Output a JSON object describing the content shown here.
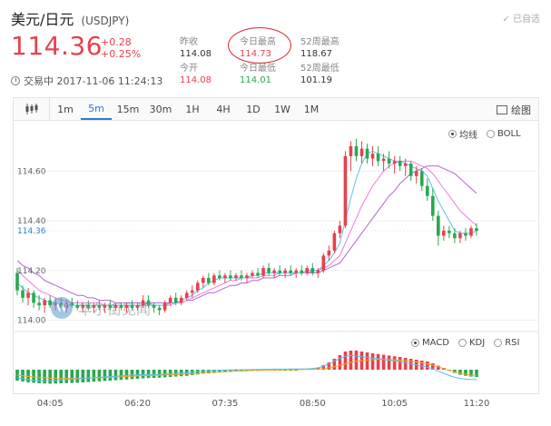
{
  "header": {
    "title": "美元/日元",
    "symbol": "(USDJPY)",
    "follow_label": "已自选",
    "price": "114.36",
    "change_abs": "+0.28",
    "change_pct": "+0.25%"
  },
  "stats": [
    {
      "label": "昨收",
      "value": "114.08",
      "tone": "normal"
    },
    {
      "label": "今日最高",
      "value": "114.73",
      "tone": "red"
    },
    {
      "label": "52周最高",
      "value": "118.67",
      "tone": "normal"
    },
    {
      "label": "今开",
      "value": "114.08",
      "tone": "red"
    },
    {
      "label": "今日最低",
      "value": "114.01",
      "tone": "green"
    },
    {
      "label": "52周最低",
      "value": "101.19",
      "tone": "normal"
    }
  ],
  "status": {
    "text": "交易中 2017-11-06 11:24:13"
  },
  "tabs": [
    {
      "label": "1m",
      "active": false
    },
    {
      "label": "5m",
      "active": true
    },
    {
      "label": "15m",
      "active": false
    },
    {
      "label": "30m",
      "active": false
    },
    {
      "label": "1H",
      "active": false
    },
    {
      "label": "4H",
      "active": false
    },
    {
      "label": "1D",
      "active": false
    },
    {
      "label": "1W",
      "active": false
    },
    {
      "label": "1M",
      "active": false
    }
  ],
  "draw_label": "绘图",
  "main_indicators": [
    {
      "label": "均线",
      "selected": true
    },
    {
      "label": "BOLL",
      "selected": false
    }
  ],
  "sub_indicators": [
    {
      "label": "MACD",
      "selected": true
    },
    {
      "label": "KDJ",
      "selected": false
    },
    {
      "label": "RSI",
      "selected": false
    }
  ],
  "watermark": {
    "logo": "W",
    "text": "华尔街见闻"
  },
  "colors": {
    "up": "#e5424d",
    "down": "#2aa850",
    "accent": "#2b7bd8",
    "ma_fast": "#5bc0eb",
    "ma_mid": "#f37ad6",
    "ma_slow": "#b066d6",
    "dea": "#f5a623"
  },
  "chart_data": {
    "type": "candlestick",
    "ylim": [
      113.98,
      114.74
    ],
    "y_ticks": [
      "114.60",
      "114.40",
      "114.20",
      "114.00"
    ],
    "current_price_label": "114.36",
    "x_ticks": [
      "04:05",
      "06:20",
      "07:35",
      "08:50",
      "10:05",
      "11:20"
    ],
    "candles": [
      [
        114.19,
        114.21,
        114.1,
        114.12
      ],
      [
        114.12,
        114.14,
        114.07,
        114.09
      ],
      [
        114.09,
        114.13,
        114.06,
        114.11
      ],
      [
        114.11,
        114.12,
        114.05,
        114.07
      ],
      [
        114.07,
        114.1,
        114.04,
        114.06
      ],
      [
        114.06,
        114.09,
        114.03,
        114.08
      ],
      [
        114.08,
        114.1,
        114.05,
        114.06
      ],
      [
        114.06,
        114.09,
        114.04,
        114.07
      ],
      [
        114.07,
        114.09,
        114.04,
        114.05
      ],
      [
        114.05,
        114.08,
        114.03,
        114.07
      ],
      [
        114.07,
        114.09,
        114.05,
        114.06
      ],
      [
        114.06,
        114.08,
        114.04,
        114.05
      ],
      [
        114.05,
        114.07,
        114.03,
        114.06
      ],
      [
        114.06,
        114.08,
        114.04,
        114.05
      ],
      [
        114.05,
        114.07,
        114.03,
        114.06
      ],
      [
        114.06,
        114.08,
        114.04,
        114.05
      ],
      [
        114.05,
        114.07,
        114.03,
        114.06
      ],
      [
        114.06,
        114.08,
        114.04,
        114.05
      ],
      [
        114.05,
        114.07,
        114.04,
        114.06
      ],
      [
        114.06,
        114.07,
        114.04,
        114.05
      ],
      [
        114.05,
        114.07,
        114.03,
        114.06
      ],
      [
        114.06,
        114.08,
        114.04,
        114.05
      ],
      [
        114.05,
        114.07,
        114.04,
        114.06
      ],
      [
        114.06,
        114.1,
        114.05,
        114.08
      ],
      [
        114.08,
        114.1,
        114.05,
        114.06
      ],
      [
        114.06,
        114.07,
        114.03,
        114.05
      ],
      [
        114.05,
        114.06,
        114.02,
        114.04
      ],
      [
        114.04,
        114.08,
        114.03,
        114.07
      ],
      [
        114.07,
        114.1,
        114.06,
        114.09
      ],
      [
        114.09,
        114.11,
        114.06,
        114.07
      ],
      [
        114.07,
        114.1,
        114.06,
        114.09
      ],
      [
        114.09,
        114.12,
        114.08,
        114.11
      ],
      [
        114.11,
        114.14,
        114.09,
        114.12
      ],
      [
        114.12,
        114.16,
        114.11,
        114.15
      ],
      [
        114.15,
        114.18,
        114.13,
        114.17
      ],
      [
        114.17,
        114.19,
        114.14,
        114.15
      ],
      [
        114.15,
        114.19,
        114.14,
        114.18
      ],
      [
        114.18,
        114.2,
        114.16,
        114.17
      ],
      [
        114.17,
        114.19,
        114.15,
        114.18
      ],
      [
        114.18,
        114.2,
        114.16,
        114.17
      ],
      [
        114.17,
        114.19,
        114.16,
        114.18
      ],
      [
        114.18,
        114.2,
        114.16,
        114.17
      ],
      [
        114.17,
        114.19,
        114.15,
        114.18
      ],
      [
        114.18,
        114.2,
        114.17,
        114.19
      ],
      [
        114.19,
        114.21,
        114.17,
        114.18
      ],
      [
        114.18,
        114.22,
        114.17,
        114.21
      ],
      [
        114.21,
        114.23,
        114.18,
        114.19
      ],
      [
        114.19,
        114.21,
        114.17,
        114.2
      ],
      [
        114.2,
        114.22,
        114.18,
        114.19
      ],
      [
        114.19,
        114.21,
        114.17,
        114.2
      ],
      [
        114.2,
        114.22,
        114.18,
        114.19
      ],
      [
        114.19,
        114.21,
        114.17,
        114.2
      ],
      [
        114.2,
        114.22,
        114.18,
        114.19
      ],
      [
        114.19,
        114.22,
        114.18,
        114.21
      ],
      [
        114.21,
        114.23,
        114.18,
        114.19
      ],
      [
        114.19,
        114.21,
        114.17,
        114.2
      ],
      [
        114.2,
        114.27,
        114.19,
        114.26
      ],
      [
        114.26,
        114.3,
        114.24,
        114.28
      ],
      [
        114.28,
        114.36,
        114.27,
        114.35
      ],
      [
        114.35,
        114.4,
        114.33,
        114.38
      ],
      [
        114.38,
        114.68,
        114.37,
        114.66
      ],
      [
        114.66,
        114.72,
        114.6,
        114.7
      ],
      [
        114.7,
        114.73,
        114.64,
        114.66
      ],
      [
        114.66,
        114.72,
        114.63,
        114.69
      ],
      [
        114.69,
        114.71,
        114.63,
        114.65
      ],
      [
        114.65,
        114.7,
        114.62,
        114.67
      ],
      [
        114.67,
        114.7,
        114.62,
        114.64
      ],
      [
        114.64,
        114.67,
        114.6,
        114.65
      ],
      [
        114.65,
        114.68,
        114.61,
        114.63
      ],
      [
        114.63,
        114.66,
        114.59,
        114.64
      ],
      [
        114.64,
        114.66,
        114.6,
        114.62
      ],
      [
        114.62,
        114.65,
        114.58,
        114.63
      ],
      [
        114.63,
        114.64,
        114.56,
        114.58
      ],
      [
        114.58,
        114.62,
        114.55,
        114.6
      ],
      [
        114.6,
        114.61,
        114.52,
        114.54
      ],
      [
        114.54,
        114.57,
        114.48,
        114.5
      ],
      [
        114.5,
        114.53,
        114.4,
        114.42
      ],
      [
        114.42,
        114.44,
        114.3,
        114.34
      ],
      [
        114.34,
        114.38,
        114.32,
        114.36
      ],
      [
        114.36,
        114.38,
        114.33,
        114.35
      ],
      [
        114.35,
        114.37,
        114.31,
        114.33
      ],
      [
        114.33,
        114.36,
        114.31,
        114.35
      ],
      [
        114.35,
        114.37,
        114.32,
        114.34
      ],
      [
        114.34,
        114.38,
        114.33,
        114.37
      ],
      [
        114.37,
        114.39,
        114.34,
        114.36
      ]
    ],
    "ma_fast": [
      114.15,
      114.13,
      114.11,
      114.1,
      114.09,
      114.08,
      114.07,
      114.07,
      114.06,
      114.06,
      114.06,
      114.06,
      114.06,
      114.06,
      114.06,
      114.06,
      114.06,
      114.06,
      114.06,
      114.06,
      114.06,
      114.06,
      114.06,
      114.06,
      114.07,
      114.06,
      114.06,
      114.06,
      114.07,
      114.07,
      114.08,
      114.09,
      114.1,
      114.12,
      114.13,
      114.15,
      114.16,
      114.17,
      114.17,
      114.17,
      114.17,
      114.17,
      114.17,
      114.18,
      114.18,
      114.19,
      114.19,
      114.19,
      114.19,
      114.19,
      114.19,
      114.19,
      114.19,
      114.2,
      114.2,
      114.2,
      114.22,
      114.24,
      114.27,
      114.31,
      114.4,
      114.49,
      114.57,
      114.63,
      114.67,
      114.68,
      114.67,
      114.66,
      114.65,
      114.64,
      114.64,
      114.63,
      114.62,
      114.61,
      114.6,
      114.58,
      114.53,
      114.48,
      114.44,
      114.4,
      114.36,
      114.35,
      114.35,
      114.35,
      114.36
    ],
    "ma_mid": [
      114.2,
      114.18,
      114.16,
      114.14,
      114.12,
      114.11,
      114.1,
      114.09,
      114.08,
      114.08,
      114.07,
      114.07,
      114.07,
      114.07,
      114.07,
      114.07,
      114.06,
      114.06,
      114.06,
      114.06,
      114.06,
      114.06,
      114.06,
      114.06,
      114.06,
      114.06,
      114.06,
      114.06,
      114.06,
      114.07,
      114.07,
      114.08,
      114.09,
      114.1,
      114.11,
      114.12,
      114.13,
      114.14,
      114.15,
      114.16,
      114.16,
      114.17,
      114.17,
      114.17,
      114.17,
      114.18,
      114.18,
      114.18,
      114.19,
      114.19,
      114.19,
      114.19,
      114.19,
      114.19,
      114.2,
      114.2,
      114.21,
      114.22,
      114.24,
      114.26,
      114.31,
      114.36,
      114.41,
      114.46,
      114.5,
      114.54,
      114.57,
      114.6,
      114.62,
      114.63,
      114.64,
      114.64,
      114.64,
      114.63,
      114.62,
      114.61,
      114.59,
      114.56,
      114.53,
      114.5,
      114.47,
      114.44,
      114.42,
      114.4,
      114.38
    ],
    "ma_slow": [
      114.24,
      114.22,
      114.21,
      114.19,
      114.18,
      114.16,
      114.15,
      114.14,
      114.13,
      114.12,
      114.11,
      114.1,
      114.1,
      114.09,
      114.09,
      114.08,
      114.08,
      114.08,
      114.07,
      114.07,
      114.07,
      114.07,
      114.07,
      114.07,
      114.07,
      114.07,
      114.07,
      114.07,
      114.07,
      114.07,
      114.07,
      114.08,
      114.08,
      114.09,
      114.1,
      114.11,
      114.11,
      114.12,
      114.13,
      114.14,
      114.14,
      114.15,
      114.15,
      114.16,
      114.16,
      114.17,
      114.17,
      114.17,
      114.18,
      114.18,
      114.18,
      114.19,
      114.19,
      114.19,
      114.19,
      114.19,
      114.2,
      114.21,
      114.22,
      114.23,
      114.26,
      114.29,
      114.32,
      114.35,
      114.38,
      114.41,
      114.44,
      114.47,
      114.5,
      114.52,
      114.55,
      114.57,
      114.59,
      114.6,
      114.61,
      114.62,
      114.62,
      114.62,
      114.61,
      114.6,
      114.59,
      114.57,
      114.55,
      114.53,
      114.51
    ],
    "macd_hist": [
      -0.6,
      -0.65,
      -0.7,
      -0.72,
      -0.75,
      -0.76,
      -0.77,
      -0.76,
      -0.75,
      -0.74,
      -0.73,
      -0.72,
      -0.7,
      -0.68,
      -0.66,
      -0.64,
      -0.62,
      -0.6,
      -0.58,
      -0.56,
      -0.54,
      -0.52,
      -0.5,
      -0.48,
      -0.46,
      -0.45,
      -0.44,
      -0.42,
      -0.4,
      -0.38,
      -0.36,
      -0.34,
      -0.3,
      -0.26,
      -0.22,
      -0.2,
      -0.18,
      -0.16,
      -0.14,
      -0.12,
      -0.1,
      -0.09,
      -0.08,
      -0.07,
      -0.06,
      -0.05,
      -0.04,
      -0.03,
      -0.03,
      -0.02,
      -0.02,
      -0.01,
      0.0,
      0.02,
      0.05,
      0.1,
      0.25,
      0.4,
      0.6,
      0.8,
      1.0,
      1.05,
      1.05,
      1.0,
      0.95,
      0.9,
      0.86,
      0.82,
      0.78,
      0.74,
      0.7,
      0.65,
      0.6,
      0.55,
      0.5,
      0.45,
      0.35,
      0.22,
      0.1,
      -0.05,
      -0.18,
      -0.28,
      -0.34,
      -0.38,
      -0.4
    ],
    "macd_dif": [
      -0.45,
      -0.5,
      -0.55,
      -0.58,
      -0.6,
      -0.6,
      -0.6,
      -0.58,
      -0.56,
      -0.55,
      -0.53,
      -0.5,
      -0.48,
      -0.46,
      -0.44,
      -0.42,
      -0.4,
      -0.38,
      -0.36,
      -0.34,
      -0.32,
      -0.3,
      -0.28,
      -0.27,
      -0.26,
      -0.26,
      -0.26,
      -0.24,
      -0.22,
      -0.2,
      -0.18,
      -0.16,
      -0.13,
      -0.1,
      -0.07,
      -0.05,
      -0.04,
      -0.03,
      -0.02,
      -0.01,
      0.0,
      0.0,
      0.0,
      0.01,
      0.01,
      0.02,
      0.02,
      0.03,
      0.03,
      0.03,
      0.04,
      0.04,
      0.04,
      0.05,
      0.07,
      0.1,
      0.2,
      0.32,
      0.48,
      0.62,
      0.74,
      0.78,
      0.76,
      0.72,
      0.68,
      0.64,
      0.6,
      0.56,
      0.52,
      0.48,
      0.44,
      0.38,
      0.32,
      0.26,
      0.2,
      0.14,
      0.05,
      -0.08,
      -0.2,
      -0.32,
      -0.42,
      -0.48,
      -0.52,
      -0.54,
      -0.55
    ],
    "macd_dea": [
      -0.3,
      -0.33,
      -0.37,
      -0.4,
      -0.43,
      -0.45,
      -0.47,
      -0.48,
      -0.49,
      -0.49,
      -0.49,
      -0.48,
      -0.47,
      -0.46,
      -0.45,
      -0.44,
      -0.43,
      -0.42,
      -0.4,
      -0.39,
      -0.37,
      -0.36,
      -0.34,
      -0.33,
      -0.32,
      -0.31,
      -0.3,
      -0.29,
      -0.28,
      -0.27,
      -0.25,
      -0.24,
      -0.22,
      -0.2,
      -0.18,
      -0.16,
      -0.14,
      -0.12,
      -0.11,
      -0.09,
      -0.08,
      -0.07,
      -0.06,
      -0.05,
      -0.04,
      -0.03,
      -0.02,
      -0.01,
      -0.01,
      0.0,
      0.0,
      0.01,
      0.01,
      0.02,
      0.02,
      0.03,
      0.06,
      0.1,
      0.16,
      0.24,
      0.32,
      0.4,
      0.46,
      0.5,
      0.53,
      0.55,
      0.56,
      0.56,
      0.55,
      0.54,
      0.52,
      0.5,
      0.47,
      0.43,
      0.38,
      0.32,
      0.25,
      0.16,
      0.06,
      -0.04,
      -0.12,
      -0.2,
      -0.26,
      -0.3,
      -0.32
    ]
  }
}
